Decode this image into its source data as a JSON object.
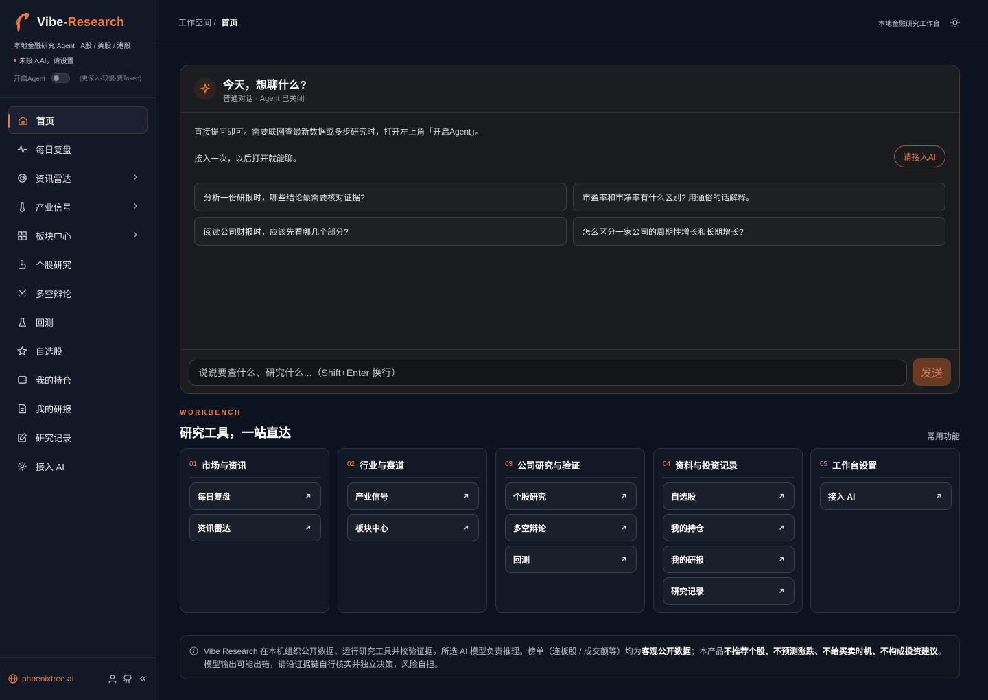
{
  "brand": {
    "name_main": "Vibe-",
    "name_accent": "Research",
    "subtitle": "本地金融研究 Agent · A股 / 美股 / 港股",
    "ai_status": "未接入AI，请设置",
    "agent_toggle_label": "开启Agent",
    "agent_hint": "(更深入·较慢·费Token)",
    "accent_color": "#f0783c"
  },
  "sidebar": {
    "items": [
      {
        "label": "首页",
        "icon": "home-icon",
        "active": true,
        "chevron": false
      },
      {
        "label": "每日复盘",
        "icon": "pulse-icon",
        "chevron": false
      },
      {
        "label": "资讯雷达",
        "icon": "radar-icon",
        "chevron": true
      },
      {
        "label": "产业信号",
        "icon": "thermometer-icon",
        "chevron": true
      },
      {
        "label": "板块中心",
        "icon": "grid-icon",
        "chevron": true
      },
      {
        "label": "个股研究",
        "icon": "microscope-icon",
        "chevron": false
      },
      {
        "label": "多空辩论",
        "icon": "swords-icon",
        "chevron": false
      },
      {
        "label": "回测",
        "icon": "flask-icon",
        "chevron": false
      },
      {
        "label": "自选股",
        "icon": "star-icon",
        "chevron": false
      },
      {
        "label": "我的持仓",
        "icon": "wallet-icon",
        "chevron": false
      },
      {
        "label": "我的研报",
        "icon": "file-icon",
        "chevron": false
      },
      {
        "label": "研究记录",
        "icon": "edit-icon",
        "chevron": false
      },
      {
        "label": "接入 AI",
        "icon": "gear-icon",
        "chevron": false
      }
    ],
    "footer_link": "phoenixtree.ai"
  },
  "header": {
    "breadcrumb_parent": "工作空间 /",
    "breadcrumb_current": "首页",
    "right_label": "本地金融研究工作台"
  },
  "chat": {
    "title": "今天，想聊什么?",
    "subtitle": "普通对话 · Agent 已关闭",
    "message1": "直接提问即可。需要联网查最新数据或多步研究时，打开左上角「开启Agent」。",
    "message2": "接入一次，以后打开就能聊。",
    "connect_button": "请接入AI",
    "suggestions": [
      "分析一份研报时，哪些结论最需要核对证据?",
      "市盈率和市净率有什么区别? 用通俗的话解释。",
      "阅读公司财报时，应该先看哪几个部分?",
      "怎么区分一家公司的周期性增长和长期增长?"
    ],
    "input_placeholder": "说说要查什么、研究什么...（Shift+Enter 换行）",
    "send_label": "发送"
  },
  "workbench": {
    "kicker": "WORKBENCH",
    "title": "研究工具，一站直达",
    "right_label": "常用功能",
    "cards": [
      {
        "num": "01",
        "name": "市场与资讯",
        "links": [
          "每日复盘",
          "资讯雷达"
        ]
      },
      {
        "num": "02",
        "name": "行业与赛道",
        "links": [
          "产业信号",
          "板块中心"
        ]
      },
      {
        "num": "03",
        "name": "公司研究与验证",
        "links": [
          "个股研究",
          "多空辩论",
          "回测"
        ]
      },
      {
        "num": "04",
        "name": "资料与投资记录",
        "links": [
          "自选股",
          "我的持仓",
          "我的研报",
          "研究记录"
        ]
      },
      {
        "num": "05",
        "name": "工作台设置",
        "links": [
          "接入 AI"
        ]
      }
    ]
  },
  "disclaimer": {
    "p1": "Vibe Research 在本机组织公开数据、运行研究工具并校验证据，所选 AI 模型负责推理。榜单（连板股 / 成交额等）均为",
    "b1": "客观公开数据",
    "p2": "；本产品",
    "b2": "不推荐个股、不预测涨跌、不给买卖时机、不构成投资建议",
    "p3": "。",
    "line2": "模型输出可能出错，请沿证据链自行核实并独立决策，风险自担。"
  }
}
